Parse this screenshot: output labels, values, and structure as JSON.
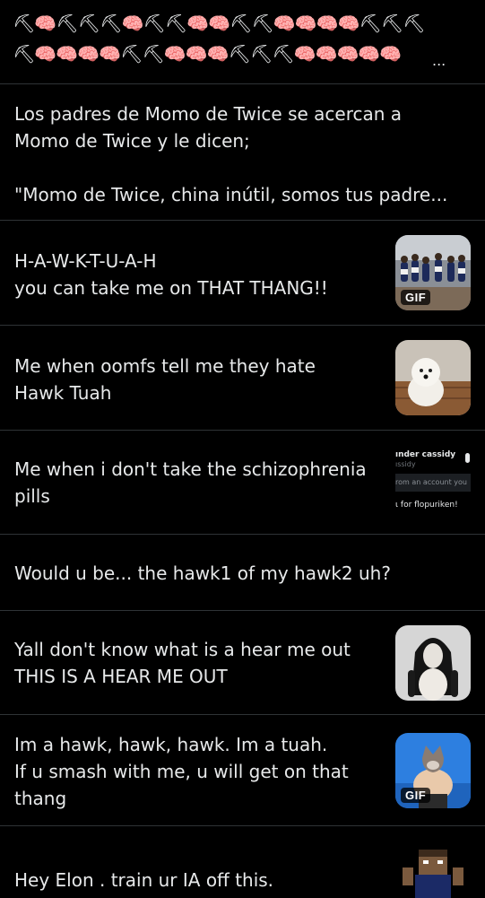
{
  "posts": [
    {
      "emoji_rows": [
        "⛏🧠⛏⛏⛏🧠⛏⛏🧠🧠⛏⛏🧠🧠🧠🧠⛏⛏⛏",
        "⛏🧠🧠🧠🧠⛏⛏🧠🧠🧠⛏⛏⛏🧠🧠🧠🧠🧠"
      ],
      "ellipsis": "..."
    },
    {
      "text": "Los padres de Momo de Twice se acercan a\nMomo de Twice y le dicen;\n\n\"Momo de Twice, china inútil, somos tus padre..."
    },
    {
      "text": "H-A-W-K-T-U-A-H\nyou can take me on THAT THANG!!",
      "badge": "GIF"
    },
    {
      "text": "Me when oomfs tell me they hate\nHawk Tuah"
    },
    {
      "text": "Me when i don't take the schizophrenia\npills",
      "thumb_name": "ınder cassidy",
      "thumb_handle": "ıssidy",
      "thumb_line1": "rom an account you",
      "thumb_line2": "ɩ for flopuriken!"
    },
    {
      "text": "Would u be... the hawk1 of my hawk2 uh?"
    },
    {
      "text": "Yall don't know what is a hear me out\nTHIS IS A HEAR ME OUT"
    },
    {
      "text": "Im a hawk, hawk, hawk. Im a tuah.\nIf u smash with me, u will get on that\nthang",
      "badge": "GIF"
    },
    {
      "text": "Hey Elon . train ur IA off this."
    }
  ]
}
